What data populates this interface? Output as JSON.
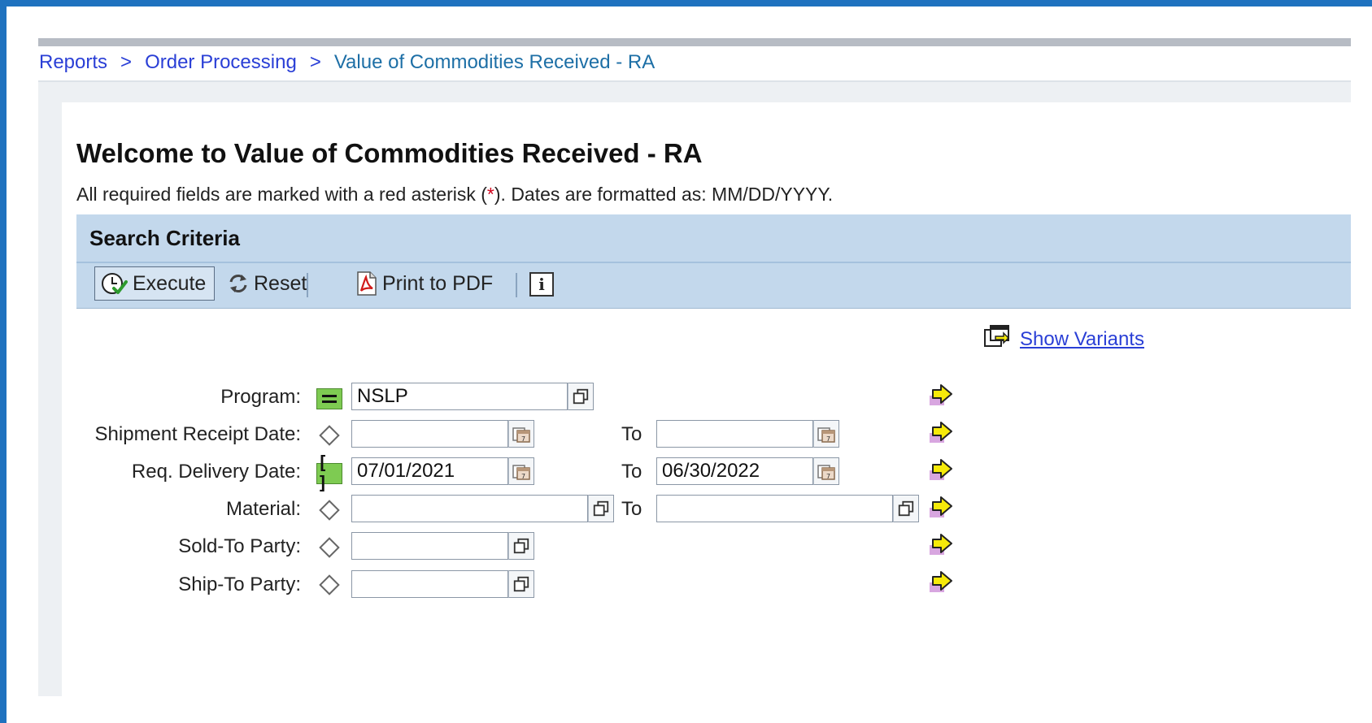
{
  "breadcrumb": {
    "items": [
      "Reports",
      "Order Processing"
    ],
    "separator": ">",
    "current": "Value of Commodities Received - RA"
  },
  "page": {
    "title": "Welcome to Value of Commodities Received - RA",
    "subtitle_before": "All required fields are marked with a red asterisk (",
    "subtitle_star": "*",
    "subtitle_after": "). Dates are formatted as: MM/DD/YYYY."
  },
  "criteria": {
    "header": "Search Criteria",
    "toolbar": {
      "execute": "Execute",
      "reset": "Reset",
      "print_pdf": "Print to PDF",
      "info": "i"
    },
    "show_variants": "Show Variants"
  },
  "fields": {
    "to_label": "To",
    "program": {
      "label": "Program:",
      "value": "NSLP"
    },
    "shipment_receipt_date": {
      "label": "Shipment Receipt Date:",
      "from": "",
      "to": ""
    },
    "req_delivery_date": {
      "label": "Req. Delivery Date:",
      "from": "07/01/2021",
      "to": "06/30/2022"
    },
    "material": {
      "label": "Material:",
      "from": "",
      "to": ""
    },
    "sold_to_party": {
      "label": "Sold-To Party:",
      "value": ""
    },
    "ship_to_party": {
      "label": "Ship-To Party:",
      "value": ""
    }
  },
  "colors": {
    "frame_blue": "#1f72bf",
    "header_blue": "#c3d8ec",
    "link_blue": "#2a3fd6",
    "selection_green": "#7ecb52",
    "arrow_yellow": "#f6ea0a"
  }
}
